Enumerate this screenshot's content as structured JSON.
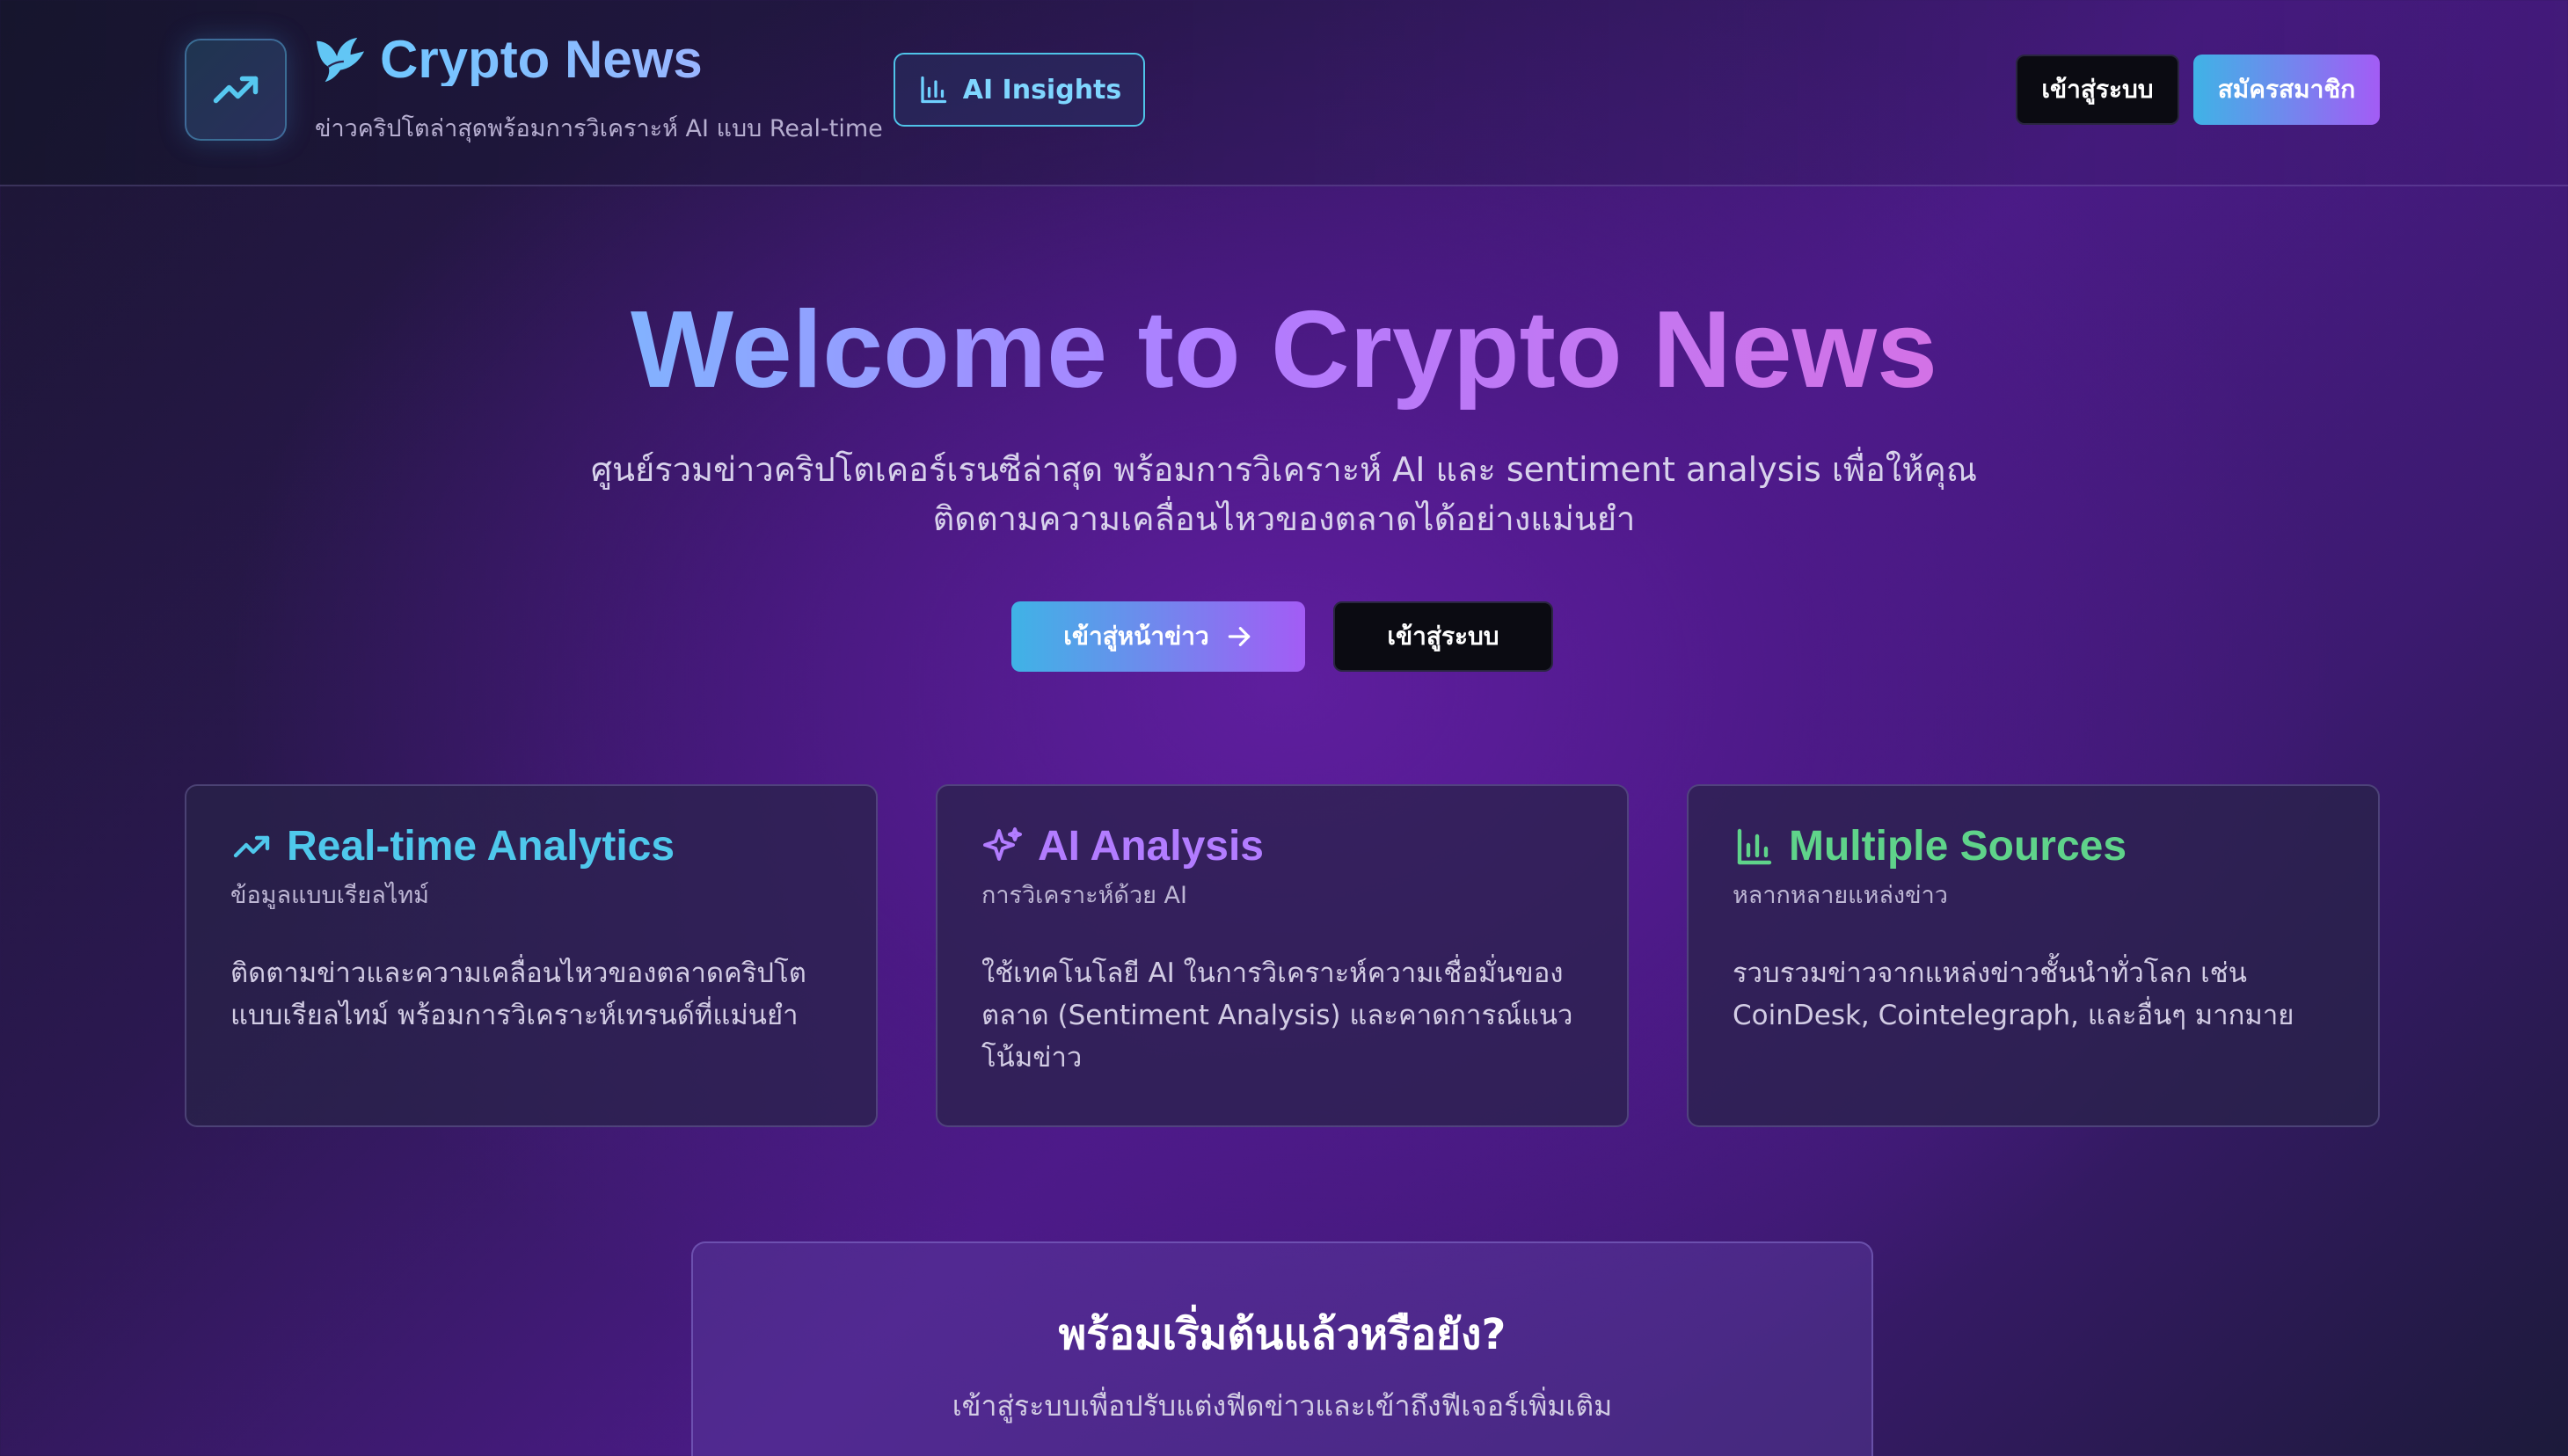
{
  "header": {
    "logo_icon": "trending-up-icon",
    "brand_icon": "bird-icon",
    "title": "Crypto News",
    "subtitle": "ข่าวคริปโตล่าสุดพร้อมการวิเคราะห์ AI แบบ Real-time",
    "insights_label": "AI Insights",
    "login_label": "เข้าสู่ระบบ",
    "signup_label": "สมัครสมาชิก"
  },
  "hero": {
    "title": "Welcome to Crypto News",
    "description": "ศูนย์รวมข่าวคริปโตเคอร์เรนซีล่าสุด พร้อมการวิเคราะห์ AI และ sentiment analysis เพื่อให้คุณติดตามความเคลื่อนไหวของตลาดได้อย่างแม่นยำ",
    "primary_cta": "เข้าสู่หน้าข่าว",
    "secondary_cta": "เข้าสู่ระบบ"
  },
  "features": [
    {
      "icon": "trending-up-icon",
      "title": "Real-time Analytics",
      "subtitle": "ข้อมูลแบบเรียลไทม์",
      "body": "ติดตามข่าวและความเคลื่อนไหวของตลาดคริปโตแบบเรียลไทม์ พร้อมการวิเคราะห์เทรนด์ที่แม่นยำ",
      "color": "#4fc8ec"
    },
    {
      "icon": "sparkles-icon",
      "title": "AI Analysis",
      "subtitle": "การวิเคราะห์ด้วย AI",
      "body": "ใช้เทคโนโลยี AI ในการวิเคราะห์ความเชื่อมั่นของตลาด (Sentiment Analysis) และคาดการณ์แนวโน้มข่าว",
      "color": "#b27cff"
    },
    {
      "icon": "bar-chart-icon",
      "title": "Multiple Sources",
      "subtitle": "หลากหลายแหล่งข่าว",
      "body": "รวบรวมข่าวจากแหล่งข่าวชั้นนำทั่วโลก เช่น CoinDesk, Cointelegraph, และอื่นๆ มากมาย",
      "color": "#5fd38a"
    }
  ],
  "bottom_cta": {
    "title": "พร้อมเริ่มต้นแล้วหรือยัง?",
    "subtitle": "เข้าสู่ระบบเพื่อปรับแต่งฟีดข่าวและเข้าถึงฟีเจอร์เพิ่มเติม"
  }
}
